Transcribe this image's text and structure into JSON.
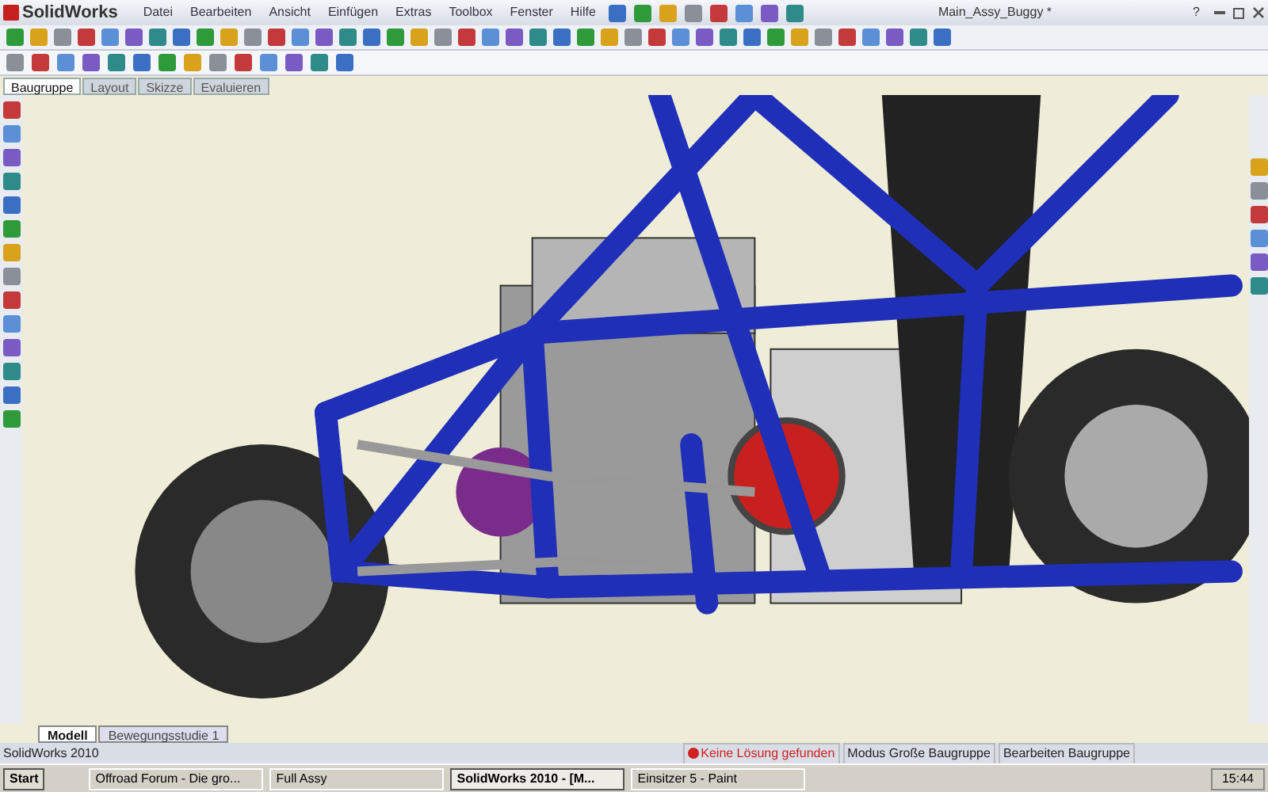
{
  "app": {
    "logo": "SolidWorks",
    "menu": [
      "Datei",
      "Bearbeiten",
      "Ansicht",
      "Einfügen",
      "Extras",
      "Toolbox",
      "Fenster",
      "Hilfe"
    ],
    "document_title": "Main_Assy_Buggy *",
    "help": "?"
  },
  "command_tabs": [
    {
      "label": "Baugruppe",
      "selected": true
    },
    {
      "label": "Layout",
      "selected": false
    },
    {
      "label": "Skizze",
      "selected": false
    },
    {
      "label": "Evaluieren",
      "selected": false
    }
  ],
  "view_tabs": [
    {
      "label": "Modell",
      "selected": true
    },
    {
      "label": "Bewegungsstudie 1",
      "selected": false
    }
  ],
  "status_bar": {
    "app_name": "SolidWorks 2010",
    "items": [
      {
        "text": "Keine Lösung gefunden",
        "kind": "error"
      },
      {
        "text": "Modus Große Baugruppe",
        "kind": "plain"
      },
      {
        "text": "Bearbeiten Baugruppe",
        "kind": "plain"
      }
    ]
  },
  "taskbar": {
    "start": "Start",
    "tasks": [
      {
        "label": "Offroad Forum - Die gro...",
        "selected": false
      },
      {
        "label": "Full Assy",
        "selected": false
      },
      {
        "label": "SolidWorks 2010 - [M...",
        "selected": true
      },
      {
        "label": "Einsitzer 5 - Paint",
        "selected": false
      }
    ],
    "clock": "15:44"
  }
}
